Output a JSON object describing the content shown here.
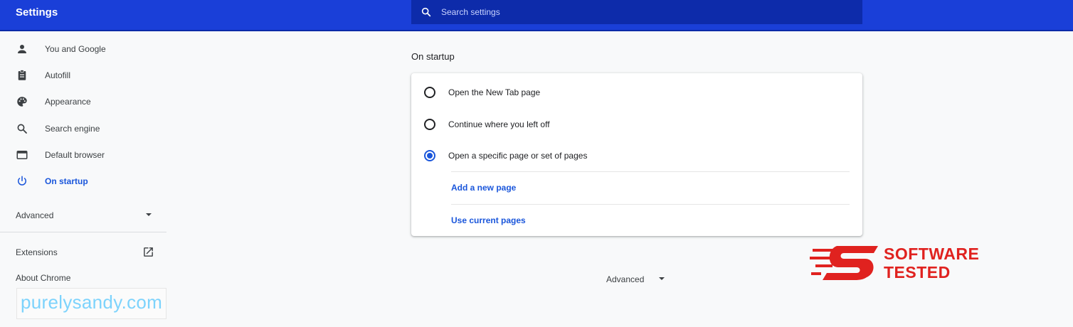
{
  "header": {
    "title": "Settings",
    "search_placeholder": "Search settings"
  },
  "sidebar": {
    "items": [
      {
        "label": "You and Google",
        "icon": "person-icon"
      },
      {
        "label": "Autofill",
        "icon": "clipboard-icon"
      },
      {
        "label": "Appearance",
        "icon": "palette-icon"
      },
      {
        "label": "Search engine",
        "icon": "search-icon"
      },
      {
        "label": "Default browser",
        "icon": "browser-window-icon"
      },
      {
        "label": "On startup",
        "icon": "power-icon",
        "active": true
      }
    ],
    "advanced_label": "Advanced",
    "extensions_label": "Extensions",
    "about_label": "About Chrome"
  },
  "main": {
    "section_title": "On startup",
    "options": [
      {
        "label": "Open the New Tab page",
        "checked": false
      },
      {
        "label": "Continue where you left off",
        "checked": false
      },
      {
        "label": "Open a specific page or set of pages",
        "checked": true
      }
    ],
    "add_page_label": "Add a new page",
    "use_current_label": "Use current pages",
    "advanced_label": "Advanced"
  },
  "overlays": {
    "watermark_text": "purelysandy.com",
    "logo_line1": "SOFTWARE",
    "logo_line2": "TESTED"
  },
  "colors": {
    "header_bg": "#1a3fd8",
    "search_bg": "#0d2baa",
    "accent": "#1a56db",
    "logo_red": "#e0221f",
    "watermark": "#7dd3fc"
  }
}
